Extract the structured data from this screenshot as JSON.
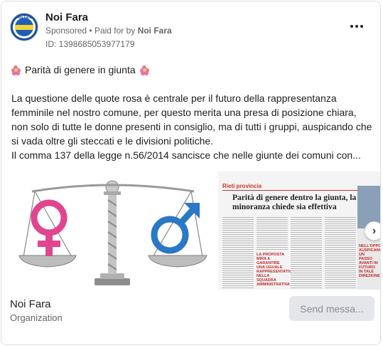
{
  "post": {
    "page_name": "Noi Fara",
    "sponsored": "Sponsored",
    "paid_for": "Paid for by",
    "payer": "Noi Fara",
    "ad_id": "ID: 1398685053977179",
    "avatar_text": "Noi Fara",
    "more_icon": "more-options-icon"
  },
  "body": {
    "title": "Parità di genere in giunta",
    "emoji_left": "cherry-blossom-icon",
    "emoji_right": "cherry-blossom-icon",
    "paragraph": "La questione delle quote rosa è centrale per il futuro della rappresentanza femminile nel nostro comune, per questo merita una presa di posizione chiara, non solo di tutte le donne presenti in consiglio, ma di tutti i gruppi, auspicando che si vada oltre gli steccati e le divisioni politiche.",
    "paragraph2": "Il comma 137 della legge n.56/2014 sancisce che nelle giunte dei comuni con..."
  },
  "media": {
    "image1": "gender-scale-image",
    "newspaper": {
      "section": "Rieti provincia",
      "headline": "Parità di genere dentro la giunta, la minoranza chiede sia effettiva",
      "red1": "LA PROPOSTA MIRA A GARANTIRE UNA UGUALE RAPPRESENTATIVITÀ NELLA SQUADRA AMMINISTRATIVA",
      "red2": "NELL'OPPOSIZIONE AUSPICANO UN PASSO AVANTI IN FUTURO IN TALE DIREZIONE"
    },
    "next_icon": "chevron-right-icon"
  },
  "footer": {
    "name": "Noi Fara",
    "category": "Organization",
    "cta": "Send messa..."
  },
  "colors": {
    "female": "#e0458f",
    "male": "#2a78c6",
    "meta_gray": "#65676b"
  }
}
